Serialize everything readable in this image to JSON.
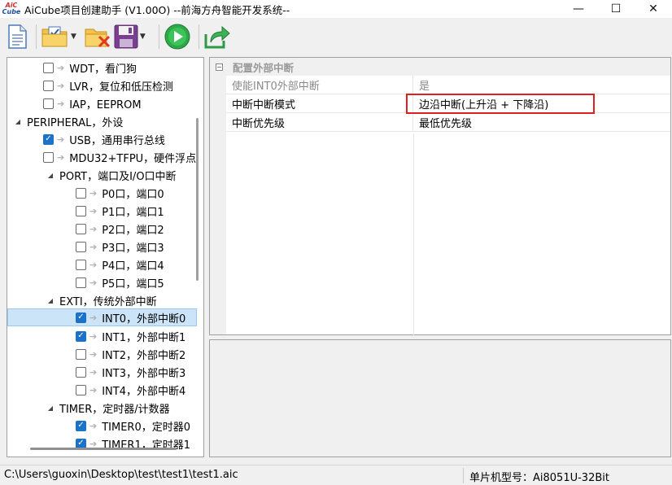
{
  "window": {
    "logo_top": "AiC",
    "logo_bottom": "Cube",
    "title": "AiCube项目创建助手 (V1.00O) --前海方舟智能开发系统--",
    "minimize": "—",
    "maximize": "☐",
    "close": "✕"
  },
  "toolbar": {
    "new": "new-document-icon",
    "open": "open-folder-icon",
    "close": "close-project-icon",
    "save": "save-icon",
    "run": "run-icon",
    "export": "export-icon"
  },
  "tree": {
    "items": [
      {
        "label": "WDT，看门狗",
        "checked": false
      },
      {
        "label": "LVR，复位和低压检测",
        "checked": false
      },
      {
        "label": "IAP，EEPROM",
        "checked": false
      },
      {
        "label": "PERIPHERAL，外设"
      },
      {
        "label": "USB，通用串行总线",
        "checked": true
      },
      {
        "label": "MDU32+TFPU，硬件浮点",
        "checked": false
      },
      {
        "label": "PORT，端口及I/O口中断"
      },
      {
        "label": "P0口，端口0",
        "checked": false
      },
      {
        "label": "P1口，端口1",
        "checked": false
      },
      {
        "label": "P2口，端口2",
        "checked": false
      },
      {
        "label": "P3口，端口3",
        "checked": false
      },
      {
        "label": "P4口，端口4",
        "checked": false
      },
      {
        "label": "P5口，端口5",
        "checked": false
      },
      {
        "label": "EXTI，传统外部中断"
      },
      {
        "label": "INT0，外部中断0",
        "checked": true
      },
      {
        "label": "INT1，外部中断1",
        "checked": true
      },
      {
        "label": "INT2，外部中断2",
        "checked": false
      },
      {
        "label": "INT3，外部中断3",
        "checked": false
      },
      {
        "label": "INT4，外部中断4",
        "checked": false
      },
      {
        "label": "TIMER，定时器/计数器"
      },
      {
        "label": "TIMER0，定时器0",
        "checked": true
      },
      {
        "label": "TIMER1，定时器1",
        "checked": true
      }
    ]
  },
  "properties": {
    "group": "配置外部中断",
    "rows": [
      {
        "name": "使能INT0外部中断",
        "value": "是"
      },
      {
        "name": "中断中断模式",
        "value": "边沿中断(上升沿 + 下降沿)"
      },
      {
        "name": "中断优先级",
        "value": "最低优先级"
      }
    ]
  },
  "status": {
    "path": "C:\\Users\\guoxin\\Desktop\\test\\test1\\test1.aic",
    "model": "单片机型号：Ai8051U-32Bit"
  }
}
